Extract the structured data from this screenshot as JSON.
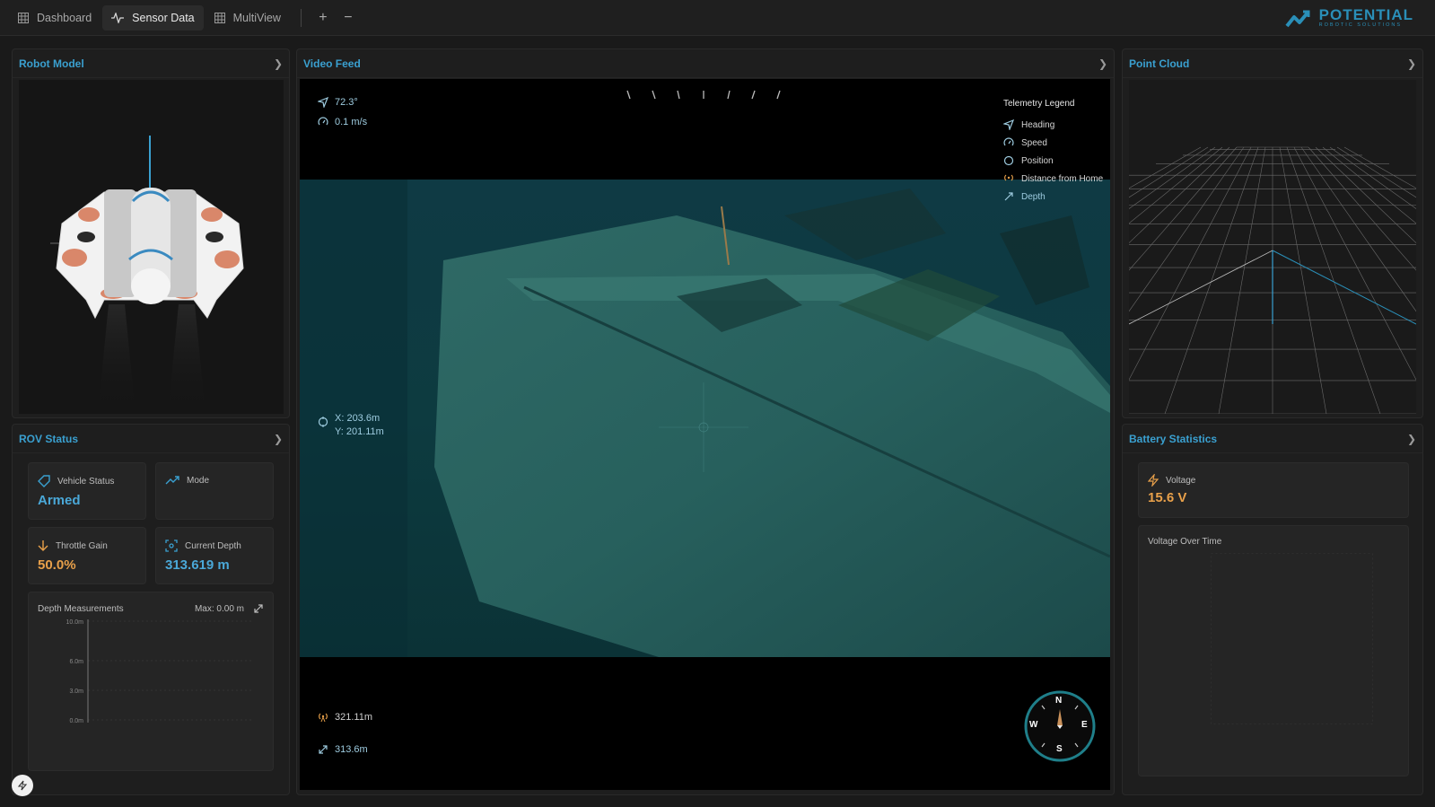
{
  "nav": {
    "tabs": [
      {
        "label": "Dashboard",
        "icon": "grid-icon"
      },
      {
        "label": "Sensor Data",
        "icon": "activity-icon"
      },
      {
        "label": "MultiView",
        "icon": "grid-icon"
      }
    ],
    "add_label": "+",
    "remove_label": "−"
  },
  "logo": {
    "main": "POTENTIAL",
    "sub": "ROBOTIC SOLUTIONS"
  },
  "panels": {
    "robot_model": "Robot Model",
    "video_feed": "Video Feed",
    "point_cloud": "Point Cloud",
    "rov_status": "ROV Status",
    "battery": "Battery Statistics"
  },
  "rov_status": {
    "vehicle_status_label": "Vehicle Status",
    "vehicle_status_value": "Armed",
    "mode_label": "Mode",
    "mode_value": "",
    "throttle_label": "Throttle Gain",
    "throttle_value": "50.0%",
    "depth_label": "Current Depth",
    "depth_value": "313.619 m",
    "depth_chart_title": "Depth Measurements",
    "depth_chart_max": "Max: 0.00 m"
  },
  "chart_data": {
    "type": "line",
    "title": "Depth Measurements",
    "y_ticks": [
      "10.0m",
      "6.0m",
      "3.0m",
      "0.0m"
    ],
    "ylim": [
      0,
      10
    ],
    "series": []
  },
  "video": {
    "heading": "72.3°",
    "speed": "0.1 m/s",
    "pos_x": "X: 203.6m",
    "pos_y": "Y: 201.11m",
    "distance_home": "321.11m",
    "depth": "313.6m",
    "compass": {
      "n": "N",
      "s": "S",
      "e": "E",
      "w": "W"
    }
  },
  "legend": {
    "title": "Telemetry Legend",
    "items": [
      "Heading",
      "Speed",
      "Position",
      "Distance from Home",
      "Depth"
    ]
  },
  "battery": {
    "voltage_label": "Voltage",
    "voltage_value": "15.6 V",
    "chart_title": "Voltage Over Time"
  },
  "colors": {
    "accent": "#3aa0d0",
    "armed": "#4aa8d8",
    "throttle": "#e8a04a",
    "voltage": "#e8a04a",
    "depth_value": "#4aa8d8"
  }
}
